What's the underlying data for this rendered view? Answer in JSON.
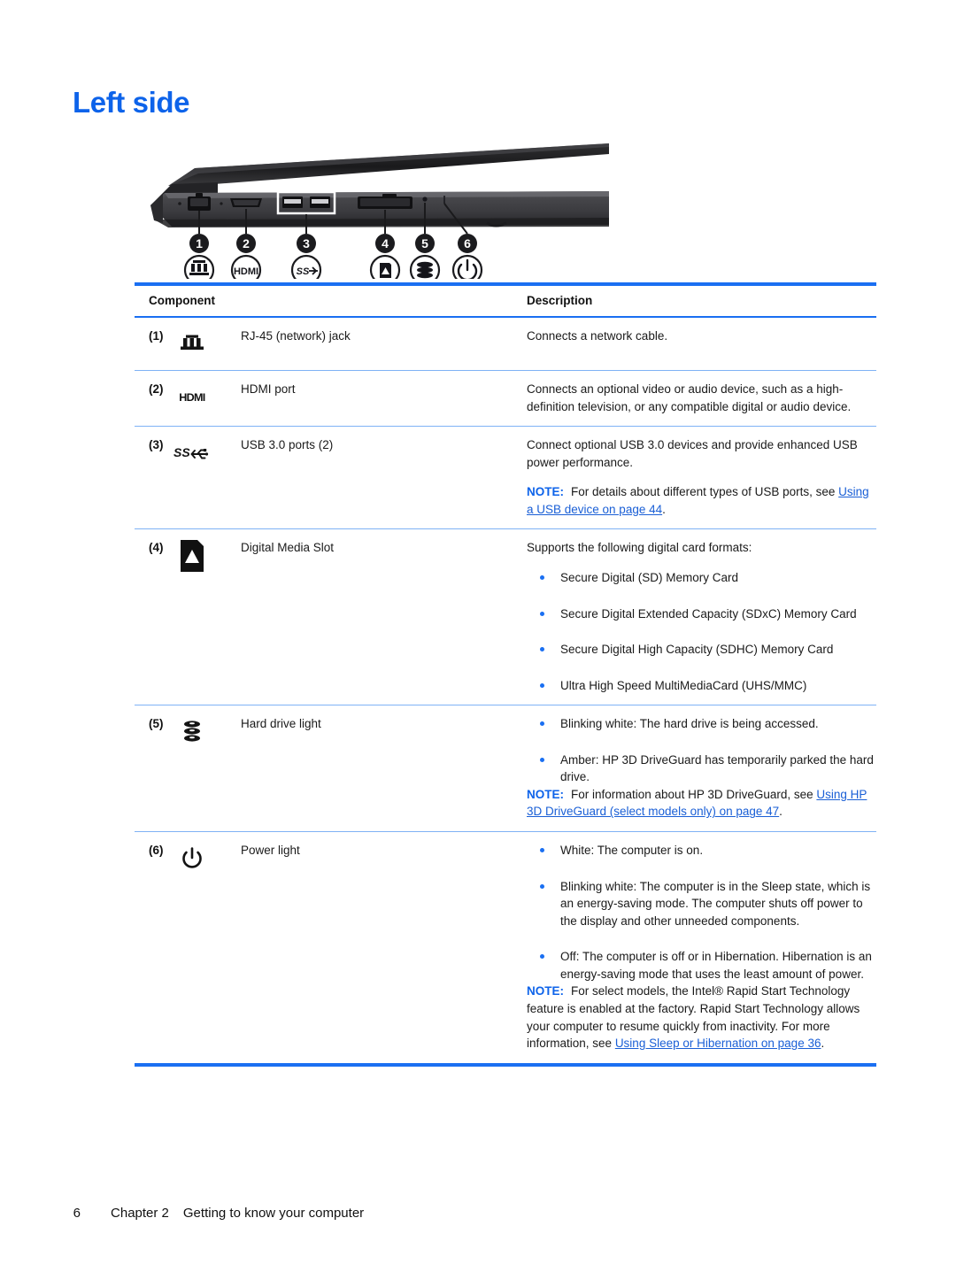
{
  "heading": "Left side",
  "colors": {
    "heading_blue": "#0d63ea",
    "rule_blue": "#1a6ff2",
    "link_blue": "#1a5fd6",
    "bullet_blue": "#1a6ff2",
    "text_black": "#1a1a1a"
  },
  "illustration": {
    "alt": "Left side of laptop showing ports",
    "callouts": [
      "1",
      "2",
      "3",
      "4",
      "5",
      "6"
    ]
  },
  "table": {
    "headers": {
      "component": "Component",
      "description": "Description"
    },
    "rows": [
      {
        "num": "(1)",
        "icon": "rj45-network-icon",
        "name": "RJ-45 (network) jack",
        "desc_paragraphs": [
          "Connects a network cable."
        ],
        "bullets": [],
        "notes": []
      },
      {
        "num": "(2)",
        "icon": "hdmi-icon",
        "icon_text": "HDMI",
        "name": "HDMI port",
        "desc_paragraphs": [
          "Connects an optional video or audio device, such as a high-definition television, or any compatible digital or audio device."
        ],
        "bullets": [],
        "notes": []
      },
      {
        "num": "(3)",
        "icon": "usb-superspeed-icon",
        "icon_text": "SS",
        "name": "USB 3.0 ports (2)",
        "desc_paragraphs": [
          "Connect optional USB 3.0 devices and provide enhanced USB power performance."
        ],
        "bullets": [],
        "notes": [
          {
            "label": "NOTE:",
            "text_before": "For details about different types of USB ports, see ",
            "link": "Using a USB device on page 44",
            "text_after": "."
          }
        ]
      },
      {
        "num": "(4)",
        "icon": "digital-media-slot-icon",
        "name": "Digital Media Slot",
        "desc_paragraphs": [
          "Supports the following digital card formats:"
        ],
        "bullets": [
          "Secure Digital (SD) Memory Card",
          "Secure Digital Extended Capacity (SDxC) Memory Card",
          "Secure Digital High Capacity (SDHC) Memory Card",
          "Ultra High Speed MultiMediaCard (UHS/MMC)"
        ],
        "notes": []
      },
      {
        "num": "(5)",
        "icon": "hard-drive-icon",
        "name": "Hard drive light",
        "desc_paragraphs": [],
        "bullets": [
          "Blinking white: The hard drive is being accessed.",
          "Amber: HP 3D DriveGuard has temporarily parked the hard drive."
        ],
        "notes": [
          {
            "label": "NOTE:",
            "text_before": "For information about HP 3D DriveGuard, see ",
            "link": "Using HP 3D DriveGuard (select models only) on page 47",
            "text_after": "."
          }
        ]
      },
      {
        "num": "(6)",
        "icon": "power-icon",
        "name": "Power light",
        "desc_paragraphs": [],
        "bullets": [
          "White: The computer is on.",
          "Blinking white: The computer is in the Sleep state, which is an energy-saving mode. The computer shuts off power to the display and other unneeded components.",
          "Off: The computer is off or in Hibernation. Hibernation is an energy-saving mode that uses the least amount of power."
        ],
        "notes": [
          {
            "label": "NOTE:",
            "text_before": "For select models, the Intel® Rapid Start Technology feature is enabled at the factory. Rapid Start Technology allows your computer to resume quickly from inactivity. For more information, see ",
            "link": "Using Sleep or Hibernation on page 36",
            "text_after": "."
          }
        ]
      }
    ]
  },
  "footer": {
    "page_number": "6",
    "chapter": "Chapter 2",
    "chapter_title": "Getting to know your computer"
  }
}
